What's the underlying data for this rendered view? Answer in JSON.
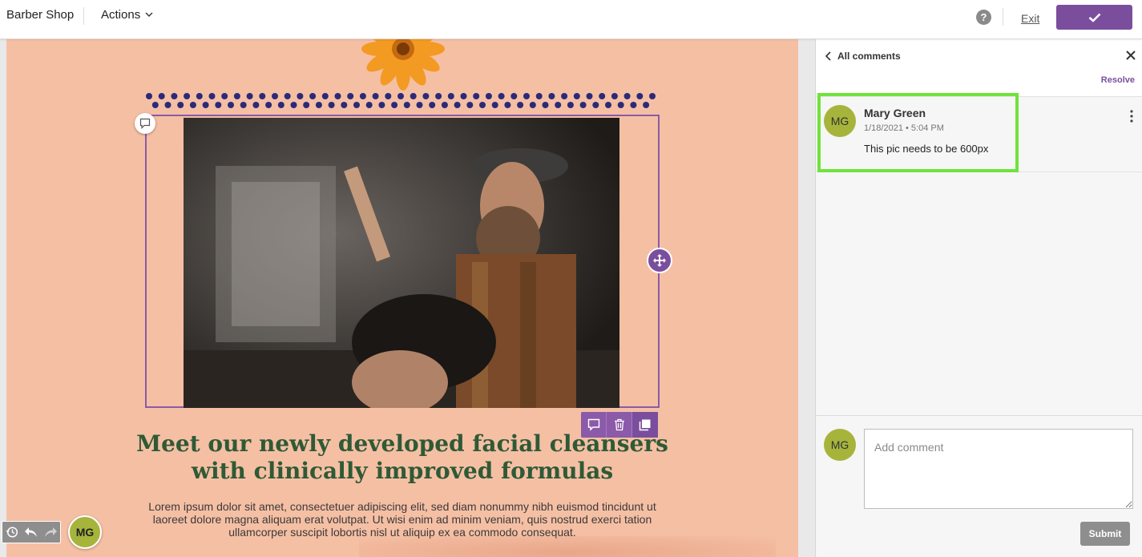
{
  "app": {
    "title": "Barber Shop",
    "actions_label": "Actions"
  },
  "topbar": {
    "help_glyph": "?",
    "exit_label": "Exit",
    "confirm_icon": "checkmark-icon"
  },
  "email": {
    "headline": "Meet our newly developed facial cleansers with clinically improved formulas",
    "body": "Lorem ipsum dolor sit amet, consectetuer adipiscing elit, sed diam nonummy nibh euismod tincidunt ut laoreet dolore magna aliquam erat volutpat. Ut wisi enim ad minim veniam, quis nostrud exerci tation ullamcorper suscipit lobortis nisl ut aliquip ex ea commodo consequat."
  },
  "editor": {
    "user_initials": "MG"
  },
  "comments_panel": {
    "back_label": "All comments",
    "resolve_label": "Resolve",
    "comment": {
      "initials": "MG",
      "author": "Mary Green",
      "date": "1/18/2021",
      "time": "5:04 PM",
      "text": "This pic needs to be 600px"
    },
    "composer": {
      "initials": "MG",
      "placeholder": "Add comment",
      "submit_label": "Submit"
    }
  },
  "colors": {
    "brand_purple": "#7a4e9d",
    "email_background": "#f5bfa4",
    "headline_green": "#2f5a36",
    "avatar_green": "#a6b43c",
    "highlight_green": "#6fe33a"
  }
}
